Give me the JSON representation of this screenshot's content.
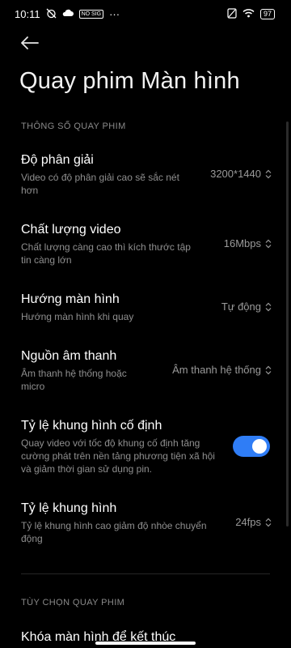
{
  "status_bar": {
    "time": "10:11",
    "badge": "NO SIG",
    "more": "···",
    "battery": "97",
    "icons": [
      "alarm-off-icon",
      "cloud-icon",
      "no-sim-icon",
      "wifi-icon"
    ]
  },
  "header": {
    "back_icon": "arrow-left-icon",
    "title": "Quay phim Màn hình"
  },
  "section_recording": {
    "label": "THÔNG SỐ QUAY PHIM",
    "items": [
      {
        "title": "Độ phân giải",
        "desc_1": "Video có độ phân giải cao sẽ sắc nét",
        "desc_2": "hơn",
        "value": "3200*1440"
      },
      {
        "title": "Chất lượng video",
        "desc_1": "Chất lượng càng cao thì kích thước tập",
        "desc_2": "tin càng lớn",
        "value": "16Mbps"
      },
      {
        "title": "Hướng màn hình",
        "desc_1": "Hướng màn hình khi quay",
        "value": "Tự động"
      },
      {
        "title": "Nguồn âm thanh",
        "desc_1": "Âm thanh hệ thống hoặc",
        "desc_2": "micro",
        "value": "Âm thanh hệ thống"
      },
      {
        "title": "Tỷ lệ khung hình cố định",
        "desc_1": "Quay video với tốc độ khung cố định tăng",
        "desc_2": "cường phát trên nền tảng phương tiện xã hội",
        "desc_3": "và giảm thời gian sử dụng pin.",
        "toggle_on": true
      },
      {
        "title": "Tỷ lệ khung hình",
        "desc_1": "Tỷ lệ khung hình cao giảm độ nhòe chuyển",
        "desc_2": "động",
        "value": "24fps"
      }
    ]
  },
  "section_options": {
    "label": "TÙY CHỌN QUAY PHIM",
    "partial_item": "Khóa màn hình để kết thúc"
  },
  "colors": {
    "accent": "#2f7df6",
    "background": "#000000",
    "secondary_text": "#8f8f8f"
  }
}
